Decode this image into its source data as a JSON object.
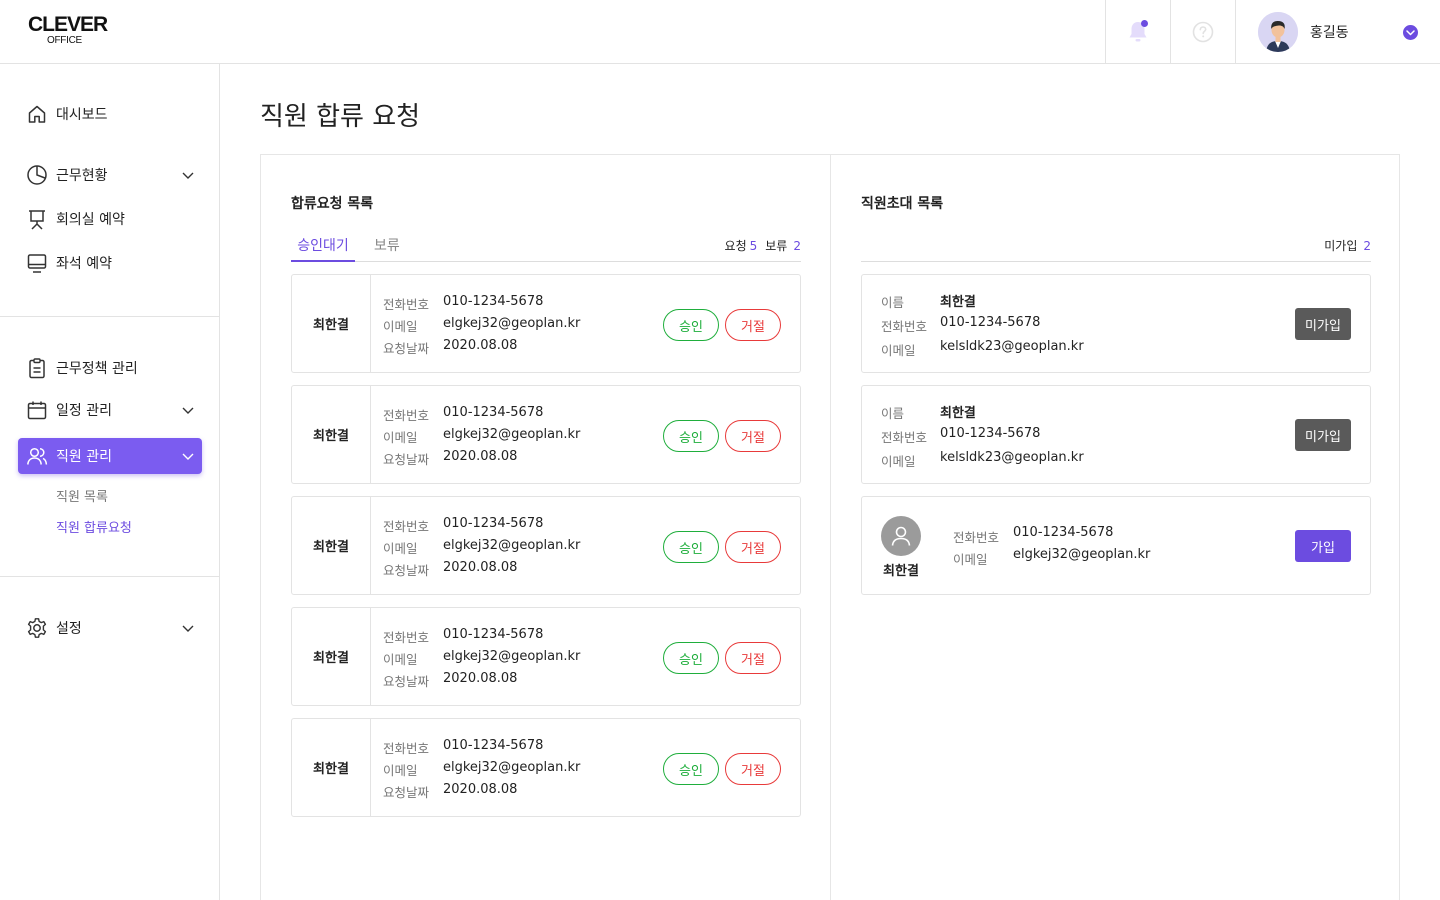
{
  "header": {
    "logo_top": "CLEVER",
    "logo_bottom": "OFFICE",
    "user_name": "홍길동",
    "accent": "#6c4ce0"
  },
  "sidebar": {
    "items": [
      {
        "label": "대시보드",
        "icon": "home-icon"
      },
      {
        "label": "근무현황",
        "icon": "pie-chart-icon",
        "expandable": true
      },
      {
        "label": "회의실 예약",
        "icon": "presentation-board-icon"
      },
      {
        "label": "좌석 예약",
        "icon": "monitor-icon"
      },
      {
        "label": "근무정책 관리",
        "icon": "clipboard-icon"
      },
      {
        "label": "일정 관리",
        "icon": "calendar-icon",
        "expandable": true
      },
      {
        "label": "직원 관리",
        "icon": "users-icon",
        "expandable": true,
        "active": true
      },
      {
        "label": "설정",
        "icon": "gear-icon",
        "expandable": true
      }
    ],
    "sub_items": [
      {
        "label": "직원 목록"
      },
      {
        "label": "직원 합류요청",
        "active": true
      }
    ]
  },
  "page": {
    "title": "직원 합류 요청"
  },
  "requests": {
    "title": "합류요청 목록",
    "tabs": [
      {
        "label": "승인대기",
        "active": true
      },
      {
        "label": "보류"
      }
    ],
    "count_request_label": "요청",
    "count_request": "5",
    "count_hold_label": "보류",
    "count_hold": "2",
    "field_labels": {
      "phone": "전화번호",
      "email": "이메일",
      "date": "요청날짜"
    },
    "approve_label": "승인",
    "reject_label": "거절",
    "items": [
      {
        "name": "최한결",
        "phone": "010-1234-5678",
        "email": "elgkej32@geoplan.kr",
        "date": "2020.08.08"
      },
      {
        "name": "최한결",
        "phone": "010-1234-5678",
        "email": "elgkej32@geoplan.kr",
        "date": "2020.08.08"
      },
      {
        "name": "최한결",
        "phone": "010-1234-5678",
        "email": "elgkej32@geoplan.kr",
        "date": "2020.08.08"
      },
      {
        "name": "최한결",
        "phone": "010-1234-5678",
        "email": "elgkej32@geoplan.kr",
        "date": "2020.08.08"
      },
      {
        "name": "최한결",
        "phone": "010-1234-5678",
        "email": "elgkej32@geoplan.kr",
        "date": "2020.08.08"
      }
    ]
  },
  "invites": {
    "title": "직원초대 목록",
    "count_label": "미가입",
    "count": "2",
    "field_labels": {
      "name": "이름",
      "phone": "전화번호",
      "email": "이메일"
    },
    "unjoined_label": "미가입",
    "join_label": "가입",
    "items": [
      {
        "name": "최한결",
        "phone": "010-1234-5678",
        "email": "kelsldk23@geoplan.kr"
      },
      {
        "name": "최한결",
        "phone": "010-1234-5678",
        "email": "kelsldk23@geoplan.kr"
      },
      {
        "name": "최한결",
        "phone": "010-1234-5678",
        "email": "elgkej32@geoplan.kr"
      }
    ]
  }
}
